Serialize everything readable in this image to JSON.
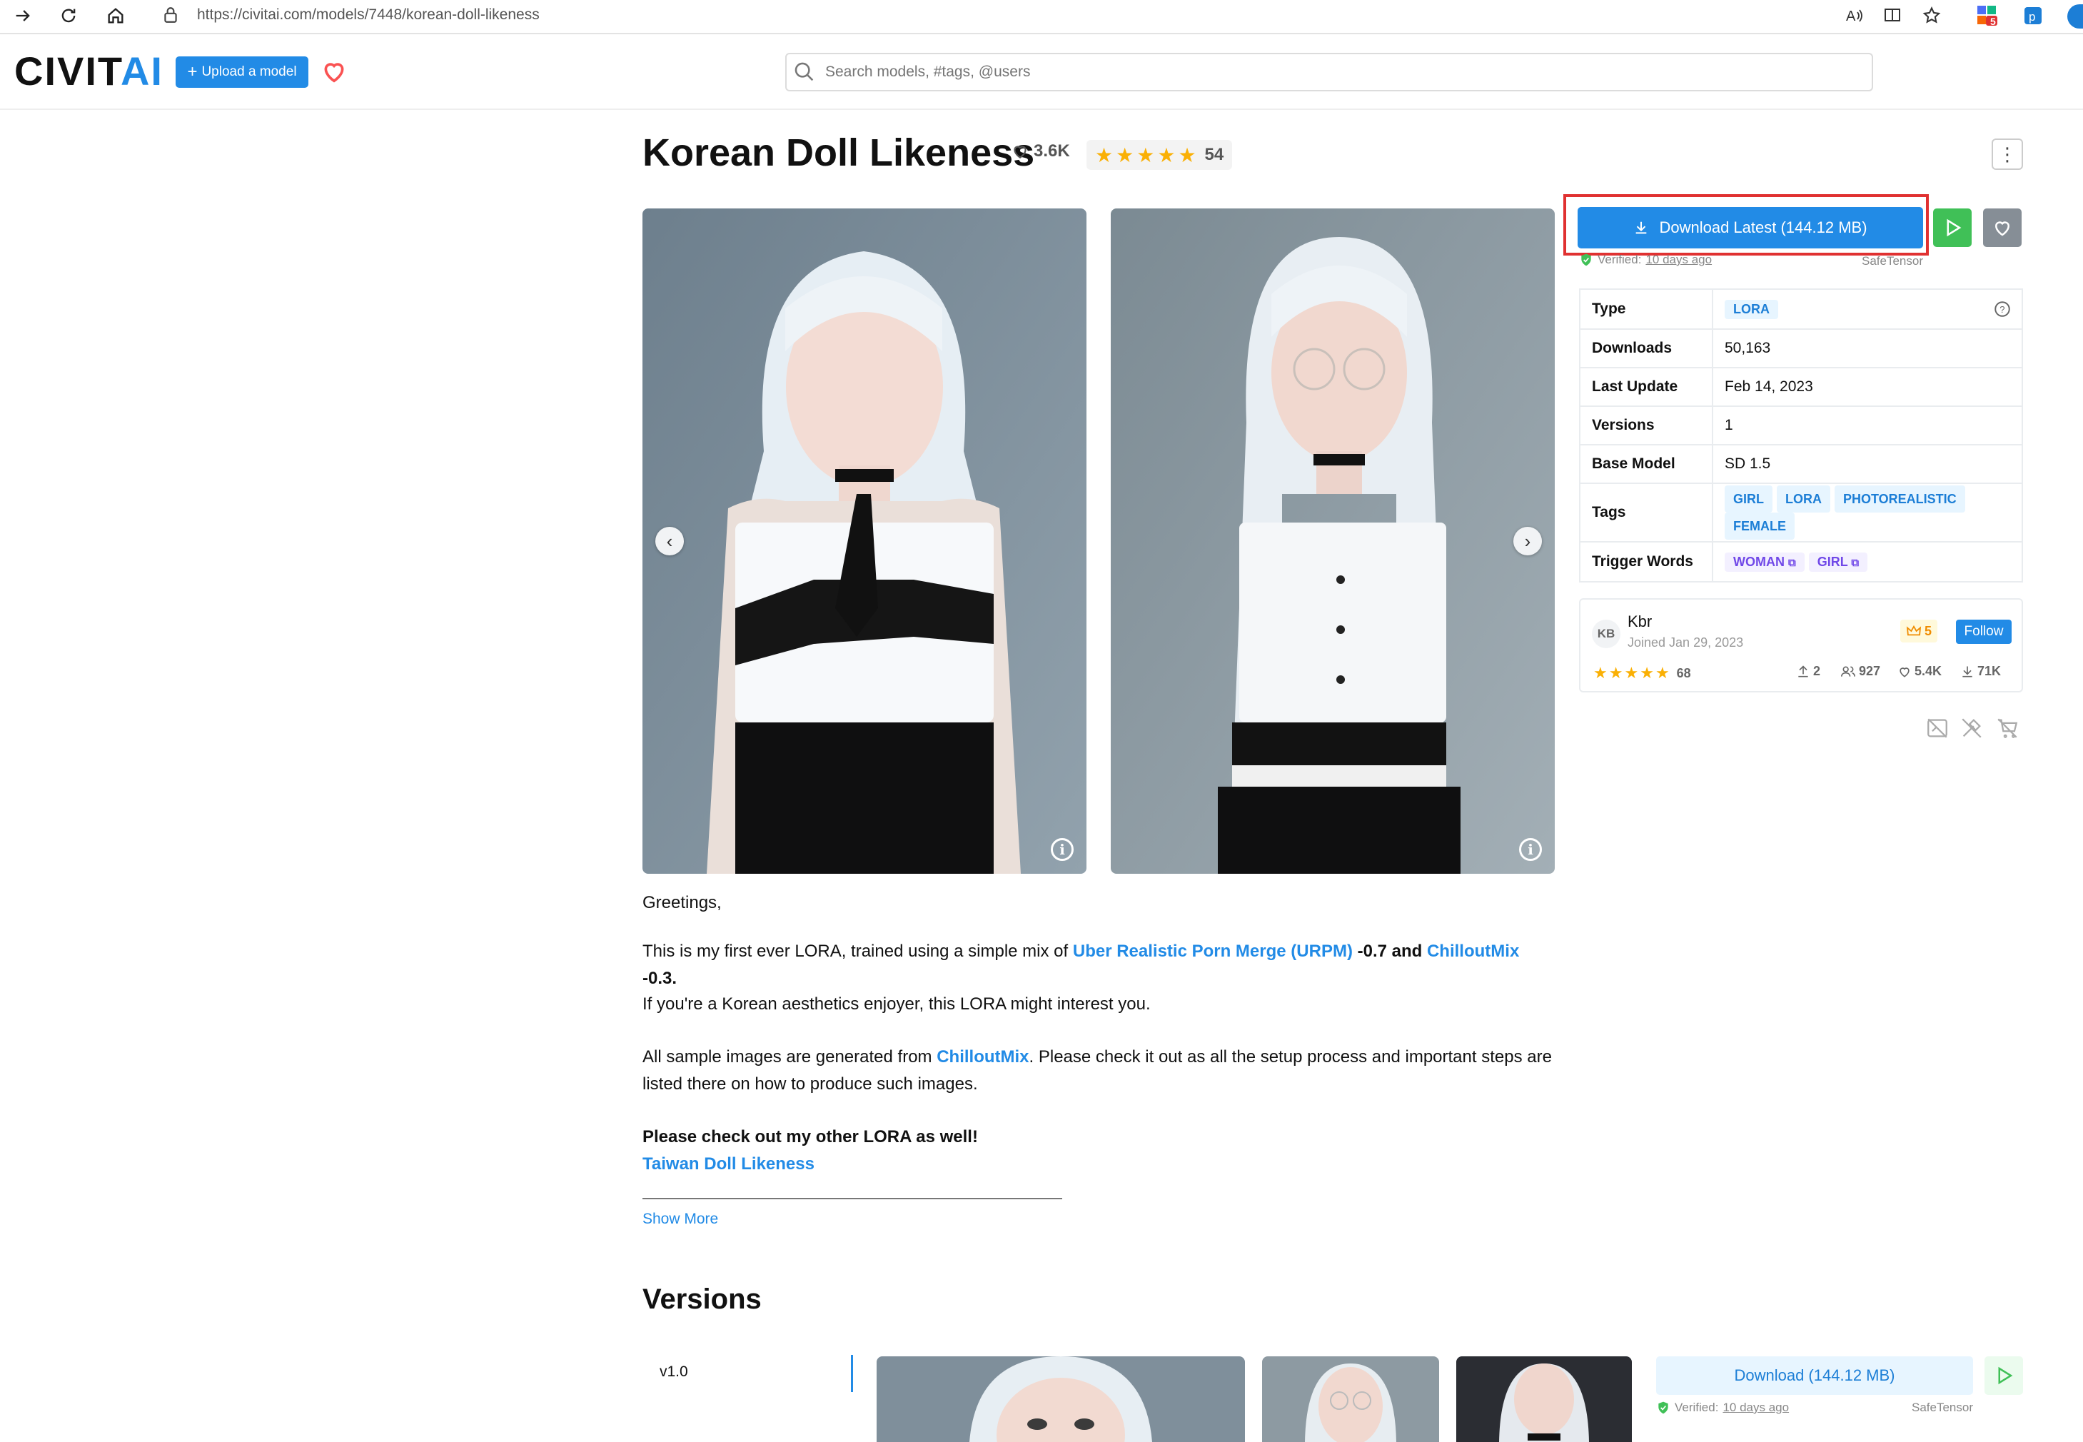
{
  "browser": {
    "url": "https://civitai.com/models/7448/korean-doll-likeness",
    "notification_count": "5"
  },
  "header": {
    "logo_part1": "CIVIT",
    "logo_part2": "AI",
    "upload_label": "Upload a model",
    "search_placeholder": "Search models, #tags, @users"
  },
  "model": {
    "title": "Korean Doll Likeness",
    "likes": "3.6K",
    "rating_count": "54",
    "rating_stars": 5
  },
  "download": {
    "label": "Download Latest (144.12 MB)",
    "verified_prefix": "Verified:",
    "verified_when": "10 days ago",
    "file_format": "SafeTensor"
  },
  "details": {
    "type_key": "Type",
    "type_value": "LORA",
    "downloads_key": "Downloads",
    "downloads_value": "50,163",
    "last_update_key": "Last Update",
    "last_update_value": "Feb 14, 2023",
    "versions_key": "Versions",
    "versions_value": "1",
    "base_model_key": "Base Model",
    "base_model_value": "SD 1.5",
    "tags_key": "Tags",
    "tags": [
      "GIRL",
      "LORA",
      "PHOTOREALISTIC",
      "FEMALE"
    ],
    "trigger_key": "Trigger Words",
    "trigger_words": [
      "WOMAN",
      "GIRL"
    ]
  },
  "creator": {
    "initials": "KB",
    "name": "Kbr",
    "joined": "Joined Jan 29, 2023",
    "rank": "5",
    "follow_label": "Follow",
    "rating_count": "68",
    "uploads": "2",
    "followers": "927",
    "favorites": "5.4K",
    "downloads": "71K"
  },
  "description": {
    "greeting": "Greetings,",
    "p1_a": "This is my first ever LORA, trained using a simple mix of ",
    "p1_link1": "Uber Realistic Porn Merge (URPM)",
    "p1_b": " -0.7 and ",
    "p1_link2": "ChilloutMix",
    "p1_c": " -0.3.",
    "p2": "If you're a Korean aesthetics enjoyer, this LORA might interest you.",
    "p3_a": "All sample images are generated from ",
    "p3_link": "ChilloutMix",
    "p3_b": ". Please check it out as all the setup process and important steps are listed there on how to produce such images.",
    "p4_bold": "Please check out my other LORA as well!",
    "p4_link": "Taiwan Doll Likeness",
    "show_more": "Show More"
  },
  "versions": {
    "title": "Versions",
    "tab": "v1.0",
    "download_label": "Download (144.12 MB)",
    "verified_prefix": "Verified:",
    "verified_when": "10 days ago",
    "file_format": "SafeTensor"
  },
  "colors": {
    "brand_blue": "#228be6",
    "play_green": "#40c057",
    "highlight_red": "#e03131",
    "star_yellow": "#fab005"
  }
}
